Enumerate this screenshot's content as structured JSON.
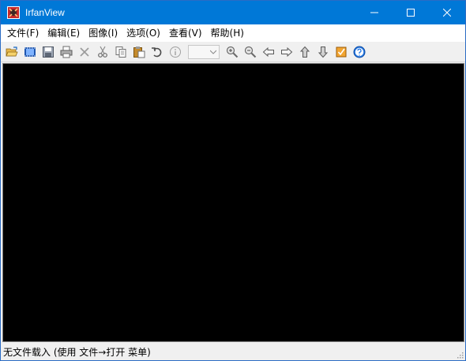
{
  "window": {
    "title": "IrfanView",
    "icon": "irfanview-cat-icon",
    "controls": [
      "minimize-icon",
      "maximize-icon",
      "close-icon"
    ],
    "accent_color": "#0078d7"
  },
  "menubar": {
    "items": [
      {
        "label": "文件(F)"
      },
      {
        "label": "编辑(E)"
      },
      {
        "label": "图像(I)"
      },
      {
        "label": "选项(O)"
      },
      {
        "label": "查看(V)"
      },
      {
        "label": "帮助(H)"
      }
    ]
  },
  "toolbar": {
    "buttons": [
      "open-folder-icon",
      "slideshow-icon",
      "save-icon",
      "print-icon",
      "delete-icon",
      "cut-icon",
      "copy-icon",
      "paste-icon",
      "undo-icon",
      "info-icon",
      "page-select",
      "zoom-in-icon",
      "zoom-out-icon",
      "previous-icon",
      "next-icon",
      "first-icon",
      "last-icon",
      "thumbnails-icon",
      "help-icon"
    ],
    "page_select_value": ""
  },
  "viewport": {
    "background_color": "#000000"
  },
  "statusbar": {
    "text": "无文件载入 (使用 文件→打开 菜单)"
  }
}
